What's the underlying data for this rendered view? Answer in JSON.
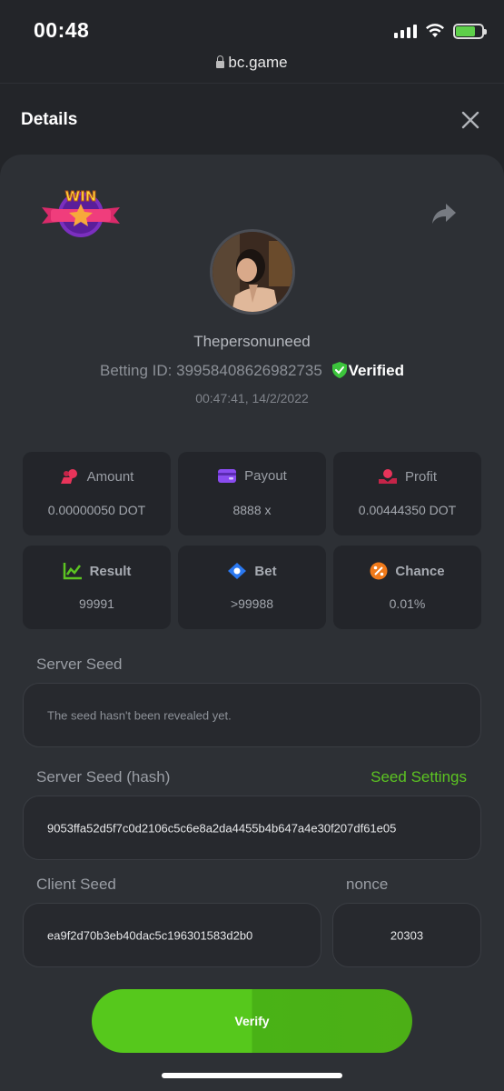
{
  "status_bar": {
    "time": "00:48"
  },
  "browser": {
    "url": "bc.game"
  },
  "header": {
    "title": "Details"
  },
  "player": {
    "username": "Thepersonuneed",
    "betting_id_label": "Betting ID:",
    "betting_id": "39958408626982735",
    "verified_label": "Verified",
    "timestamp": "00:47:41, 14/2/2022",
    "badge_text": "WIN"
  },
  "stats": {
    "amount": {
      "label": "Amount",
      "value": "0.00000050 DOT"
    },
    "payout": {
      "label": "Payout",
      "value": "8888 x"
    },
    "profit": {
      "label": "Profit",
      "value": "0.00444350 DOT"
    },
    "result": {
      "label": "Result",
      "value": "99991"
    },
    "bet": {
      "label": "Bet",
      "value": ">99988"
    },
    "chance": {
      "label": "Chance",
      "value": "0.01%"
    }
  },
  "seeds": {
    "server_seed_label": "Server Seed",
    "server_seed_value": "The seed hasn't been revealed yet.",
    "server_hash_label": "Server Seed (hash)",
    "seed_settings_label": "Seed Settings",
    "server_hash_value": "9053ffa52d5f7c0d2106c5c6e8a2da4455b4b647a4e30f207df61e05",
    "client_seed_label": "Client Seed",
    "client_seed_value": "ea9f2d70b3eb40dac5c196301583d2b0",
    "nonce_label": "nonce",
    "nonce_value": "20303"
  },
  "actions": {
    "verify_label": "Verify"
  },
  "colors": {
    "accent_green": "#5cc422",
    "verified_green": "#3cc43c",
    "card_bg": "#2d3035"
  }
}
